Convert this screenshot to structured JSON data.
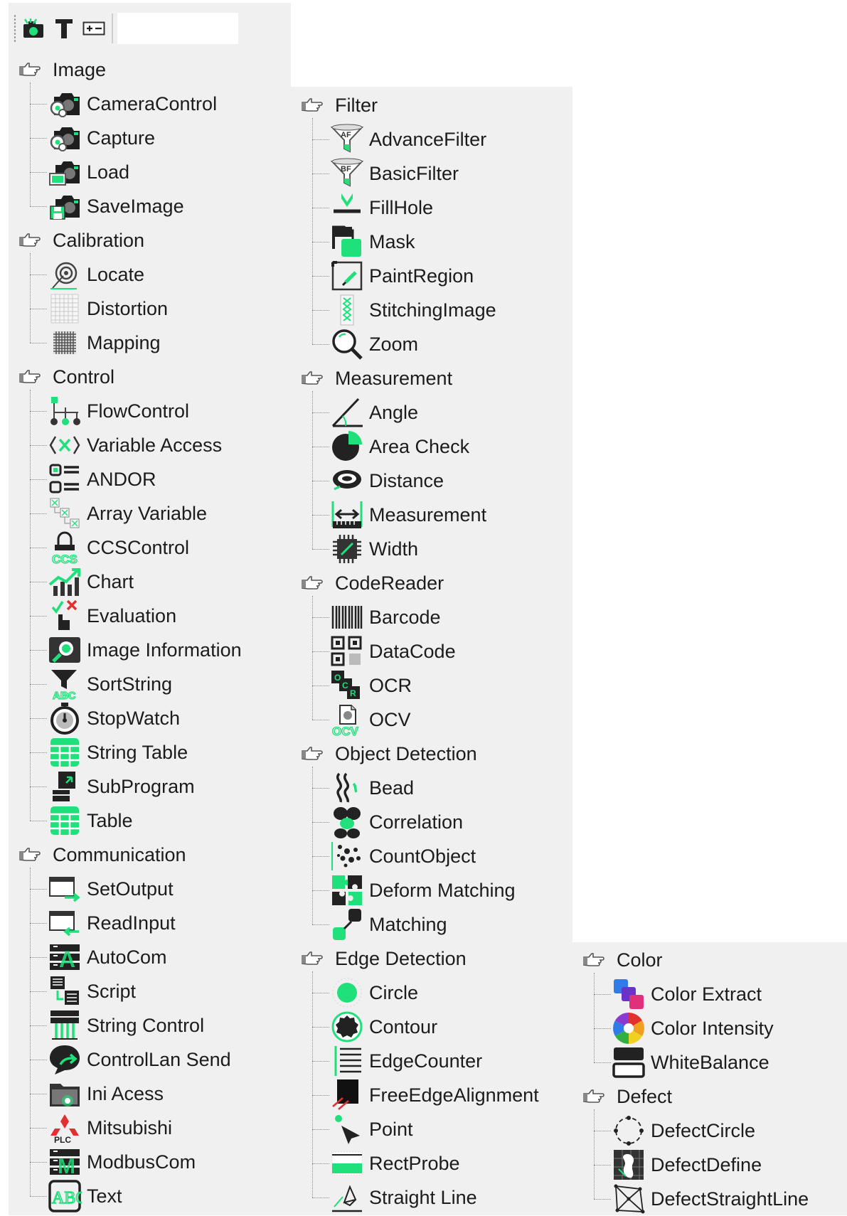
{
  "toolbar": {
    "buttons": [
      {
        "icon": "add-tool-icon"
      },
      {
        "icon": "text-icon"
      },
      {
        "icon": "expand-collapse-icon"
      }
    ],
    "search_value": ""
  },
  "colors": {
    "accent": "#1fe07a",
    "panel": "#f0f0f0",
    "red": "#e03030",
    "blue": "#2f7be8"
  },
  "columns": [
    {
      "categories": [
        {
          "label": "Image",
          "items": [
            {
              "label": "CameraControl",
              "icon": "camera-gear-icon"
            },
            {
              "label": "Capture",
              "icon": "camera-gear-icon"
            },
            {
              "label": "Load",
              "icon": "camera-load-icon"
            },
            {
              "label": "SaveImage",
              "icon": "camera-save-icon"
            }
          ]
        },
        {
          "label": "Calibration",
          "items": [
            {
              "label": "Locate",
              "icon": "target-icon"
            },
            {
              "label": "Distortion",
              "icon": "grid-icon"
            },
            {
              "label": "Mapping",
              "icon": "mapping-grid-icon"
            }
          ]
        },
        {
          "label": "Control",
          "items": [
            {
              "label": "FlowControl",
              "icon": "flowchart-icon"
            },
            {
              "label": "Variable Access",
              "icon": "variable-icon"
            },
            {
              "label": "ANDOR",
              "icon": "andor-icon"
            },
            {
              "label": "Array Variable",
              "icon": "array-icon"
            },
            {
              "label": "CCSControl",
              "icon": "lock-ccs-icon"
            },
            {
              "label": "Chart",
              "icon": "chart-icon"
            },
            {
              "label": "Evaluation",
              "icon": "evaluation-icon"
            },
            {
              "label": "Image Information",
              "icon": "image-info-icon"
            },
            {
              "label": "SortString",
              "icon": "sort-string-icon"
            },
            {
              "label": "StopWatch",
              "icon": "stopwatch-icon"
            },
            {
              "label": "String Table",
              "icon": "table-icon"
            },
            {
              "label": "SubProgram",
              "icon": "subprogram-icon"
            },
            {
              "label": "Table",
              "icon": "table-icon"
            }
          ]
        },
        {
          "label": "Communication",
          "items": [
            {
              "label": "SetOutput",
              "icon": "window-out-icon"
            },
            {
              "label": "ReadInput",
              "icon": "window-in-icon"
            },
            {
              "label": "AutoCom",
              "icon": "autocom-icon"
            },
            {
              "label": "Script",
              "icon": "script-icon"
            },
            {
              "label": "String Control",
              "icon": "string-control-icon"
            },
            {
              "label": "ControlLan Send",
              "icon": "chat-send-icon"
            },
            {
              "label": "Ini Acess",
              "icon": "folder-icon"
            },
            {
              "label": "Mitsubishi",
              "icon": "plc-icon"
            },
            {
              "label": "ModbusCom",
              "icon": "modbus-icon"
            },
            {
              "label": "Text",
              "icon": "text-abc-icon"
            }
          ]
        }
      ]
    },
    {
      "categories": [
        {
          "label": "Filter",
          "items": [
            {
              "label": "AdvanceFilter",
              "icon": "funnel-af-icon"
            },
            {
              "label": "BasicFilter",
              "icon": "funnel-bf-icon"
            },
            {
              "label": "FillHole",
              "icon": "fill-hole-icon"
            },
            {
              "label": "Mask",
              "icon": "mask-icon"
            },
            {
              "label": "PaintRegion",
              "icon": "paint-region-icon"
            },
            {
              "label": "StitchingImage",
              "icon": "stitching-icon"
            },
            {
              "label": "Zoom",
              "icon": "zoom-icon"
            }
          ]
        },
        {
          "label": "Measurement",
          "items": [
            {
              "label": "Angle",
              "icon": "angle-icon"
            },
            {
              "label": "Area Check",
              "icon": "pie-icon"
            },
            {
              "label": "Distance",
              "icon": "distance-icon"
            },
            {
              "label": "Measurement",
              "icon": "ruler-icon"
            },
            {
              "label": "Width",
              "icon": "chip-icon"
            }
          ]
        },
        {
          "label": "CodeReader",
          "items": [
            {
              "label": "Barcode",
              "icon": "barcode-icon"
            },
            {
              "label": "DataCode",
              "icon": "datacode-icon"
            },
            {
              "label": "OCR",
              "icon": "ocr-icon"
            },
            {
              "label": "OCV",
              "icon": "ocv-icon"
            }
          ]
        },
        {
          "label": "Object Detection",
          "items": [
            {
              "label": "Bead",
              "icon": "bead-icon"
            },
            {
              "label": "Correlation",
              "icon": "correlation-icon"
            },
            {
              "label": "CountObject",
              "icon": "count-object-icon"
            },
            {
              "label": "Deform Matching",
              "icon": "puzzle-icon"
            },
            {
              "label": "Matching",
              "icon": "matching-icon"
            }
          ]
        },
        {
          "label": "Edge Detection",
          "items": [
            {
              "label": "Circle",
              "icon": "circle-icon"
            },
            {
              "label": "Contour",
              "icon": "contour-icon"
            },
            {
              "label": "EdgeCounter",
              "icon": "edge-counter-icon"
            },
            {
              "label": "FreeEdgeAlignment",
              "icon": "free-edge-icon"
            },
            {
              "label": "Point",
              "icon": "point-icon"
            },
            {
              "label": "RectProbe",
              "icon": "rect-probe-icon"
            },
            {
              "label": "Straight Line",
              "icon": "straight-line-icon"
            }
          ]
        }
      ]
    },
    {
      "categories": [
        {
          "label": "Color",
          "items": [
            {
              "label": "Color Extract",
              "icon": "color-extract-icon"
            },
            {
              "label": "Color Intensity",
              "icon": "color-wheel-icon"
            },
            {
              "label": "WhiteBalance",
              "icon": "white-balance-icon"
            }
          ]
        },
        {
          "label": "Defect",
          "items": [
            {
              "label": "DefectCircle",
              "icon": "defect-circle-icon"
            },
            {
              "label": "DefectDefine",
              "icon": "defect-define-icon"
            },
            {
              "label": "DefectStraightLine",
              "icon": "defect-line-icon"
            }
          ]
        }
      ]
    }
  ]
}
